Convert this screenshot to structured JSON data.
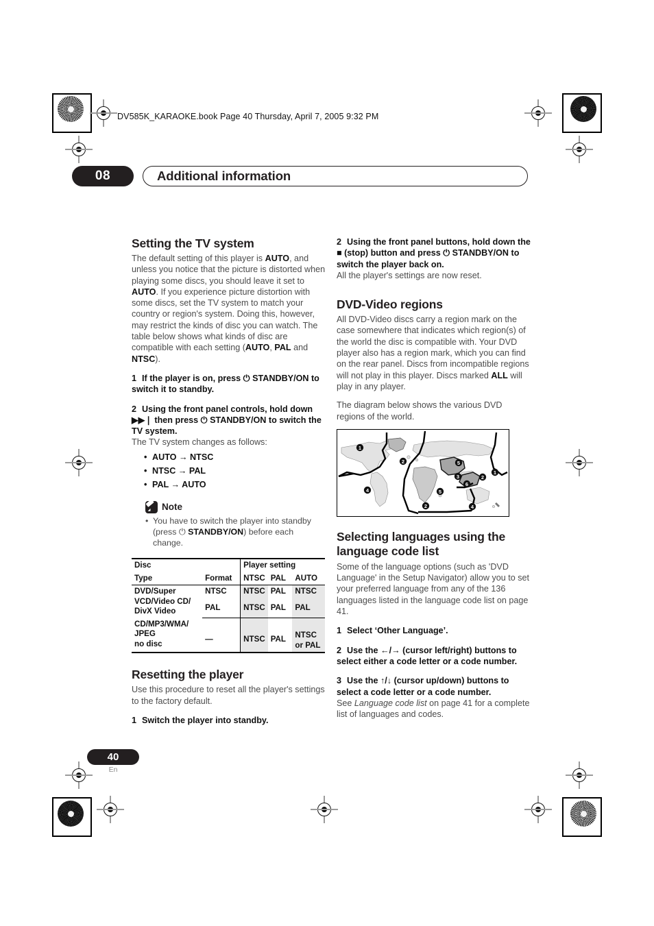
{
  "print_marks": {
    "book_line": "DV585K_KARAOKE.book  Page 40  Thursday, April 7, 2005  9:32 PM"
  },
  "chapter": {
    "number": "08",
    "title": "Additional information"
  },
  "footer": {
    "page_number": "40",
    "language_code": "En"
  },
  "left_column": {
    "section1": {
      "heading": "Setting the TV system",
      "intro_parts": [
        "The default setting of this player is ",
        "AUTO",
        ", and unless you notice that the picture is distorted when playing some discs, you should leave it set to ",
        "AUTO",
        ". If you experience picture distortion with some discs, set the TV system to match your country or region's system. Doing this, however, may restrict the kinds of disc you can watch. The table below shows what kinds of disc are compatible with each setting (",
        "AUTO",
        ", ",
        "PAL",
        " and ",
        "NTSC",
        ")."
      ],
      "steps": [
        {
          "num": "1",
          "text": "If the player is on, press ⏻ STANDBY/ON to switch it to standby."
        },
        {
          "num": "2",
          "text": "Using the front panel controls, hold down ▶▶❘ then press ⏻ STANDBY/ON to switch the TV system."
        }
      ],
      "step2_sub": "The TV system changes as follows:",
      "transitions": [
        "AUTO → NTSC",
        "NTSC → PAL",
        "PAL → AUTO"
      ],
      "note": {
        "title": "Note",
        "items_parts": [
          [
            "You have to switch the player into standby (press ⏻ ",
            "STANDBY/ON",
            ") before each change."
          ]
        ]
      },
      "table": {
        "header_row1": {
          "disc": "Disc",
          "player_setting": "Player setting"
        },
        "header_row2": {
          "type": "Type",
          "format": "Format",
          "ntsc": "NTSC",
          "pal": "PAL",
          "auto": "AUTO"
        },
        "rows": [
          {
            "type": "DVD/Super VCD/Video CD/ DivX Video",
            "type_lines": [
              "DVD/Super",
              "VCD/Video CD/",
              "DivX Video"
            ],
            "formats": [
              {
                "format": "NTSC",
                "ntsc": "NTSC",
                "pal": "PAL",
                "auto": "NTSC"
              },
              {
                "format": "PAL",
                "ntsc": "NTSC",
                "pal": "PAL",
                "auto": "PAL"
              }
            ]
          },
          {
            "type_lines": [
              "CD/MP3/WMA/",
              "JPEG",
              "no disc"
            ],
            "formats": [
              {
                "format": "—",
                "ntsc": "NTSC",
                "pal": "PAL",
                "auto": "NTSC or PAL"
              }
            ]
          }
        ]
      }
    },
    "section2": {
      "heading": "Resetting the player",
      "intro": "Use this procedure to reset all the player's settings to the factory default.",
      "steps": [
        {
          "num": "1",
          "text": "Switch the player into standby."
        }
      ]
    }
  },
  "right_column": {
    "reset_continued": {
      "step": {
        "num": "2",
        "text": "Using the front panel buttons, hold down the ■ (stop) button and press ⏻ STANDBY/ON to switch the player back on."
      },
      "sub": "All the player's settings are now reset."
    },
    "section_regions": {
      "heading": "DVD-Video regions",
      "para1_parts": [
        "All DVD-Video discs carry a region mark on the case somewhere that indicates which region(s) of the world the disc is compatible with. Your DVD player also has a region mark, which you can find on the rear panel. Discs from incompatible regions will not play in this player. Discs marked ",
        "ALL",
        " will play in any player."
      ],
      "para2": "The diagram below shows the various DVD regions of the world.",
      "map": {
        "caption": "",
        "region_labels": [
          "1",
          "2",
          "3",
          "4",
          "5",
          "6"
        ]
      }
    },
    "section_languages": {
      "heading": "Selecting languages using the language code list",
      "intro": "Some of the language options (such as 'DVD Language' in the Setup Navigator) allow you to set your preferred language from any of the 136 languages listed in the language code list on page 41.",
      "steps": [
        {
          "num": "1",
          "text": "Select ‘Other Language’."
        },
        {
          "num": "2",
          "text": "Use the ←/→ (cursor left/right) buttons to select either a code letter or a code number."
        },
        {
          "num": "3",
          "text": "Use the ↑/↓ (cursor up/down) buttons to select a code letter or a code number."
        }
      ],
      "closing_parts": [
        "See ",
        "Language code list",
        " on page 41 for a complete list of languages and codes."
      ]
    }
  },
  "colors": {
    "ink": "#231f20",
    "body_text": "#4b4b4b",
    "table_shade": "#e7e7e7"
  }
}
